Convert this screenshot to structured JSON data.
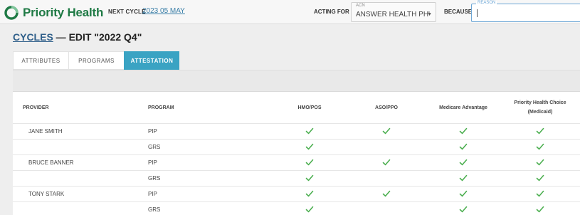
{
  "header": {
    "logo_text": "Priority Health",
    "next_cycle_label": "NEXT CYCLE",
    "next_cycle_value": "2023 05 MAY",
    "acting_for_label": "ACTING FOR",
    "acn_caption": "ACN",
    "acn_value": "ANSWER HEALTH PH'",
    "because_label": "BECAUSE",
    "reason_caption": "REASON",
    "reason_value": ""
  },
  "page": {
    "breadcrumb_link": "CYCLES",
    "title_rest": " — EDIT \"2022 Q4\""
  },
  "tabs": [
    {
      "label": "ATTRIBUTES",
      "active": false
    },
    {
      "label": "PROGRAMS",
      "active": false
    },
    {
      "label": "ATTESTATION",
      "active": true
    }
  ],
  "table": {
    "headers": {
      "provider": "PROVIDER",
      "program": "PROGRAM",
      "hmo": "HMO/POS",
      "aso": "ASO/PPO",
      "medicare": "Medicare Advantage",
      "phc_line1": "Priority Health Choice",
      "phc_line2": "(Medicaid)"
    },
    "rows": [
      {
        "provider": "JANE SMITH",
        "program": "PIP",
        "hmo": true,
        "aso": true,
        "medicare": true,
        "phc": true
      },
      {
        "provider": "",
        "program": "GRS",
        "hmo": true,
        "aso": false,
        "medicare": true,
        "phc": true
      },
      {
        "provider": "BRUCE BANNER",
        "program": "PIP",
        "hmo": true,
        "aso": true,
        "medicare": true,
        "phc": true
      },
      {
        "provider": "",
        "program": "GRS",
        "hmo": true,
        "aso": false,
        "medicare": true,
        "phc": true
      },
      {
        "provider": "TONY STARK",
        "program": "PIP",
        "hmo": true,
        "aso": true,
        "medicare": true,
        "phc": true
      },
      {
        "provider": "",
        "program": "GRS",
        "hmo": true,
        "aso": false,
        "medicare": true,
        "phc": true
      }
    ]
  },
  "colors": {
    "brand_green": "#1f7a45",
    "tab_active": "#3aa3c3",
    "check_green": "#4caf50",
    "link_blue": "#3b7fa8"
  },
  "icons": {
    "logo": "priority-health-logo-icon",
    "dropdown": "chevron-down-icon",
    "check": "checkmark-icon"
  }
}
